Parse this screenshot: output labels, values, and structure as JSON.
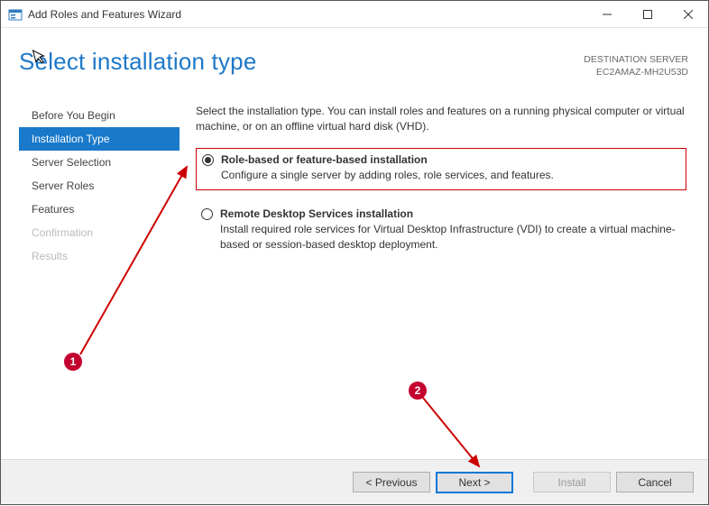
{
  "window": {
    "title": "Add Roles and Features Wizard"
  },
  "header": {
    "page_title": "Select installation type",
    "dest_label": "DESTINATION SERVER",
    "dest_value": "EC2AMAZ-MH2U53D"
  },
  "nav": {
    "items": [
      {
        "label": "Before You Begin",
        "state": "normal"
      },
      {
        "label": "Installation Type",
        "state": "active"
      },
      {
        "label": "Server Selection",
        "state": "normal"
      },
      {
        "label": "Server Roles",
        "state": "normal"
      },
      {
        "label": "Features",
        "state": "normal"
      },
      {
        "label": "Confirmation",
        "state": "disabled"
      },
      {
        "label": "Results",
        "state": "disabled"
      }
    ]
  },
  "content": {
    "intro": "Select the installation type. You can install roles and features on a running physical computer or virtual machine, or on an offline virtual hard disk (VHD).",
    "options": [
      {
        "title": "Role-based or feature-based installation",
        "desc": "Configure a single server by adding roles, role services, and features.",
        "checked": true,
        "highlighted": true
      },
      {
        "title": "Remote Desktop Services installation",
        "desc": "Install required role services for Virtual Desktop Infrastructure (VDI) to create a virtual machine-based or session-based desktop deployment.",
        "checked": false,
        "highlighted": false
      }
    ]
  },
  "footer": {
    "previous": "< Previous",
    "next": "Next >",
    "install": "Install",
    "cancel": "Cancel"
  },
  "annotations": {
    "callout1": "1",
    "callout2": "2"
  }
}
